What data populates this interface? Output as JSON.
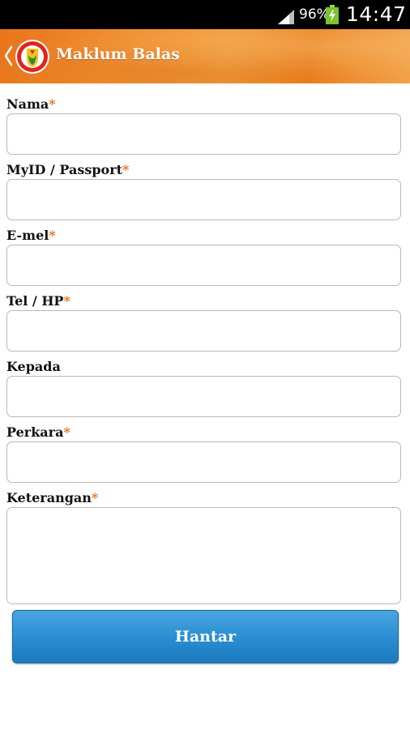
{
  "status_bar": {
    "battery_percent": "96%",
    "time": "14:47"
  },
  "header": {
    "title": "Maklum Balas"
  },
  "form": {
    "required_marker": "*",
    "fields": [
      {
        "label": "Nama",
        "required": true,
        "value": ""
      },
      {
        "label": "MyID / Passport",
        "required": true,
        "value": ""
      },
      {
        "label": "E-mel",
        "required": true,
        "value": ""
      },
      {
        "label": "Tel / HP",
        "required": true,
        "value": ""
      },
      {
        "label": "Kepada",
        "required": false,
        "value": ""
      },
      {
        "label": "Perkara",
        "required": true,
        "value": ""
      },
      {
        "label": "Keterangan",
        "required": true,
        "value": ""
      }
    ],
    "submit_label": "Hantar"
  },
  "colors": {
    "header_orange": "#e8751c",
    "required_asterisk": "#e8731c",
    "button_blue": "#2b8fd3"
  }
}
